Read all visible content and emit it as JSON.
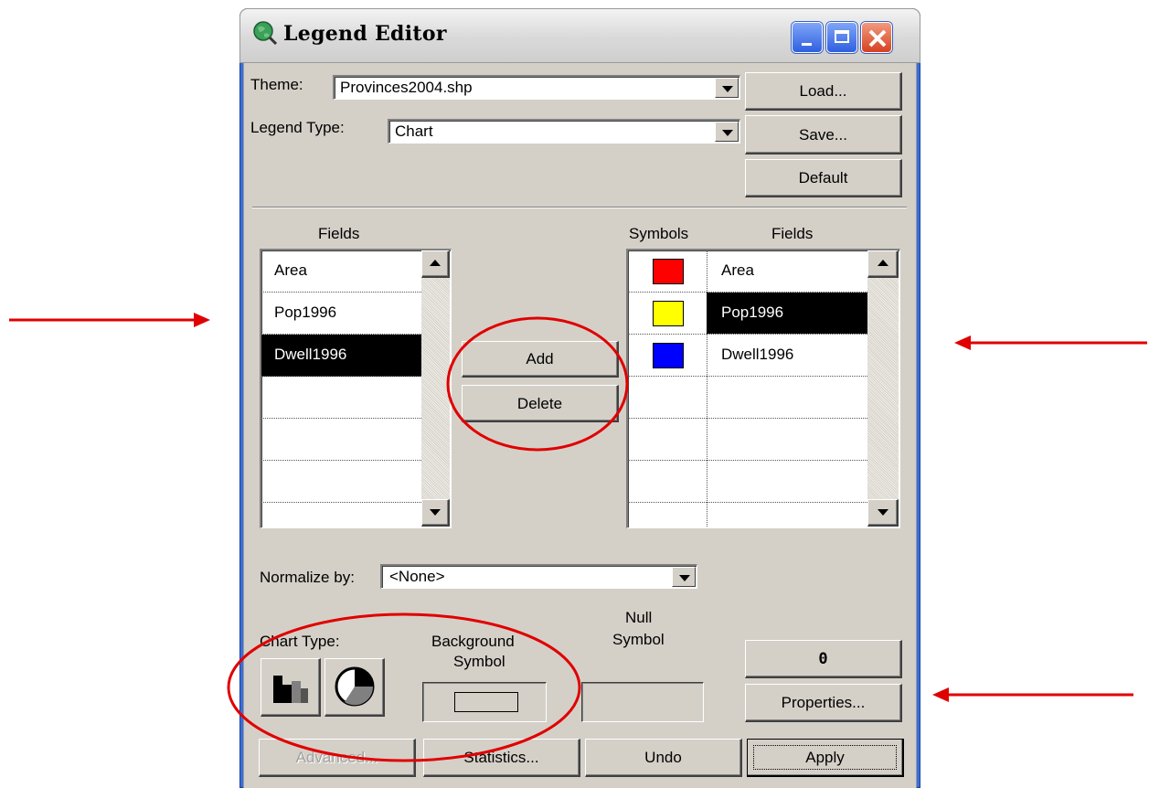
{
  "window": {
    "title": "Legend Editor"
  },
  "top": {
    "theme_label": "Theme:",
    "theme_value": "Provinces2004.shp",
    "legend_type_label": "Legend Type:",
    "legend_type_value": "Chart",
    "load_button": "Load...",
    "save_button": "Save...",
    "default_button": "Default"
  },
  "left_list": {
    "header": "Fields",
    "items": [
      "Area",
      "Pop1996",
      "Dwell1996"
    ],
    "selected": "Dwell1996"
  },
  "middle": {
    "add_button": "Add",
    "delete_button": "Delete"
  },
  "right_list": {
    "symbols_header": "Symbols",
    "fields_header": "Fields",
    "rows": [
      {
        "field": "Area",
        "color": "#ff0000"
      },
      {
        "field": "Pop1996",
        "color": "#ffff00"
      },
      {
        "field": "Dwell1996",
        "color": "#0000ff"
      }
    ],
    "selected": "Pop1996"
  },
  "normalize": {
    "label": "Normalize by:",
    "value": "<None>"
  },
  "chart": {
    "chart_type_label": "Chart Type:",
    "background_symbol_label_1": "Background",
    "background_symbol_label_2": "Symbol",
    "null_symbol_label_1": "Null",
    "null_symbol_label_2": "Symbol",
    "value_display": "0",
    "properties_button": "Properties..."
  },
  "bottom": {
    "advanced_button": "Advanced...",
    "statistics_button": "Statistics...",
    "undo_button": "Undo",
    "apply_button": "Apply"
  },
  "colors": {
    "annotation": "#e00000",
    "selection": "#000000",
    "face": "#d4d0c8"
  }
}
